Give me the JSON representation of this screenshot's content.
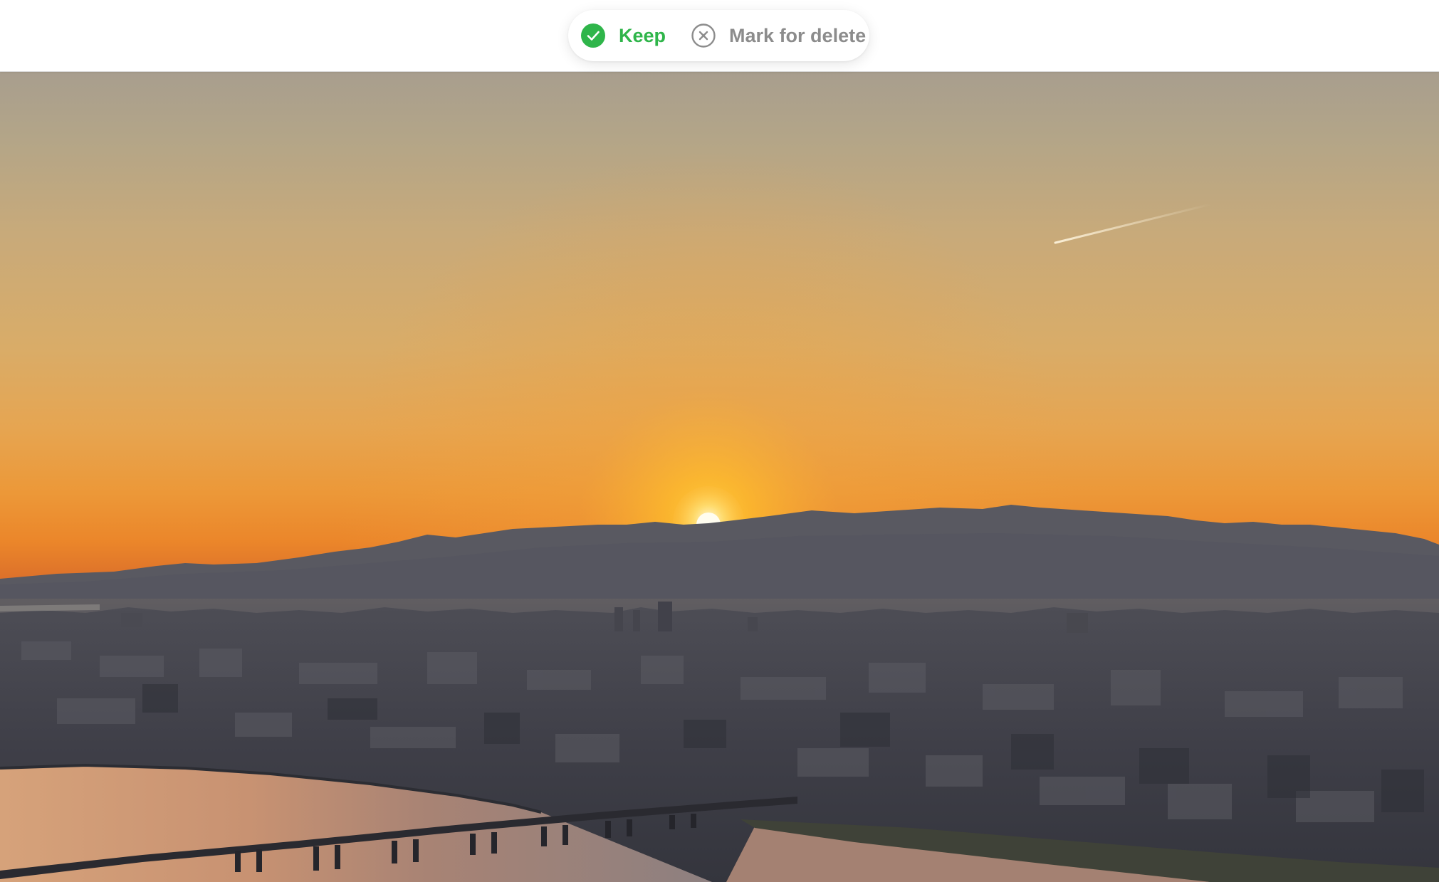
{
  "toolbar": {
    "keep_label": "Keep",
    "delete_label": "Mark for delete",
    "keep_icon": "check-circle-icon",
    "delete_icon": "x-circle-icon"
  },
  "colors": {
    "keep": "#2fb54a",
    "delete": "#8c8c8c"
  }
}
